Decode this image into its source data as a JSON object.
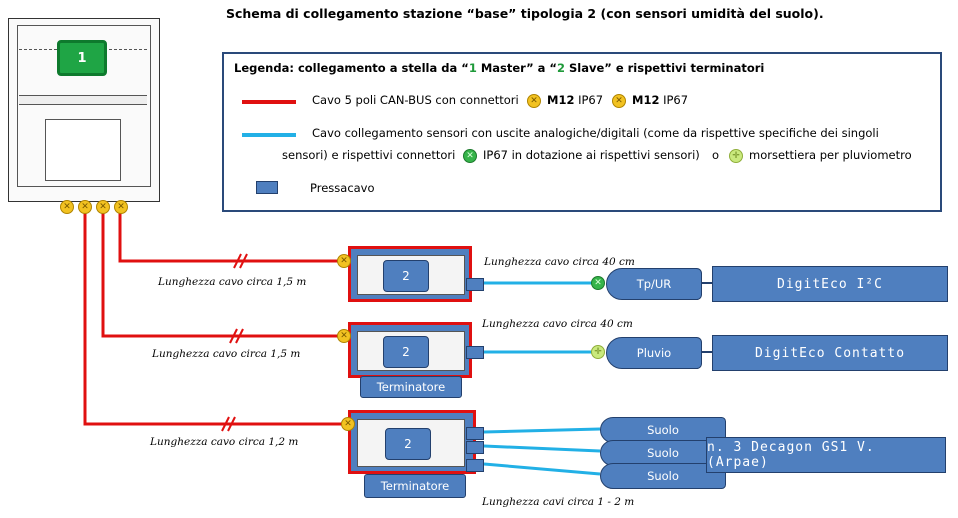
{
  "title": "Schema di collegamento stazione “base” tipologia 2 (con sensori umidità del suolo).",
  "legend": {
    "title_pre": "Legenda: collegamento a stella da “",
    "title_n1": "1",
    "title_mid1": " Master” a “",
    "title_n2": "2",
    "title_post": " Slave” e rispettivi terminatori",
    "can_text": "Cavo 5 poli CAN-BUS con connettori",
    "can_conn1": "M12",
    "can_conn1_suffix": "IP67",
    "can_conn2": "M12",
    "can_conn2_suffix": "IP67",
    "sensor_line1": "Cavo collegamento sensori con uscite analogiche/digitali (come da rispettive specifiche dei singoli",
    "sensor_line2a": "sensori) e rispettivi connettori",
    "sensor_line2b": "IP67 in dotazione ai rispettivi sensori)",
    "sensor_line2c": "o",
    "sensor_line2d": "morsettiera per pluviometro",
    "pressacavo": "Pressacavo",
    "colors": {
      "can": "#e01010",
      "sensor": "#22b0e6",
      "box": "#2a4a7a"
    }
  },
  "master": {
    "label": "1"
  },
  "slaves": [
    {
      "label": "2",
      "cable_length": "Lunghezza cavo circa 1,5 m",
      "sensor_cable": "Lunghezza cavo circa 40 cm",
      "sensor": "Tp/UR",
      "device": "DigitEco I²C"
    },
    {
      "label": "2",
      "cable_length": "Lunghezza cavo circa 1,5 m",
      "sensor_cable": "Lunghezza cavo circa 40 cm",
      "sensor": "Pluvio",
      "device": "DigitEco Contatto",
      "terminator": "Terminatore"
    },
    {
      "label": "2",
      "cable_length": "Lunghezza cavo circa 1,2 m",
      "sensor_cable": "Lunghezza cavi circa 1 - 2 m",
      "sensors": [
        "Suolo",
        "Suolo",
        "Suolo"
      ],
      "device": "n. 3 Decagon GS1 V. (Arpae)",
      "terminator": "Terminatore"
    }
  ],
  "icons": {
    "connector_m12": "yellow-connector-icon",
    "connector_ip67": "green-connector-icon",
    "terminal": "light-green-connector-icon"
  }
}
